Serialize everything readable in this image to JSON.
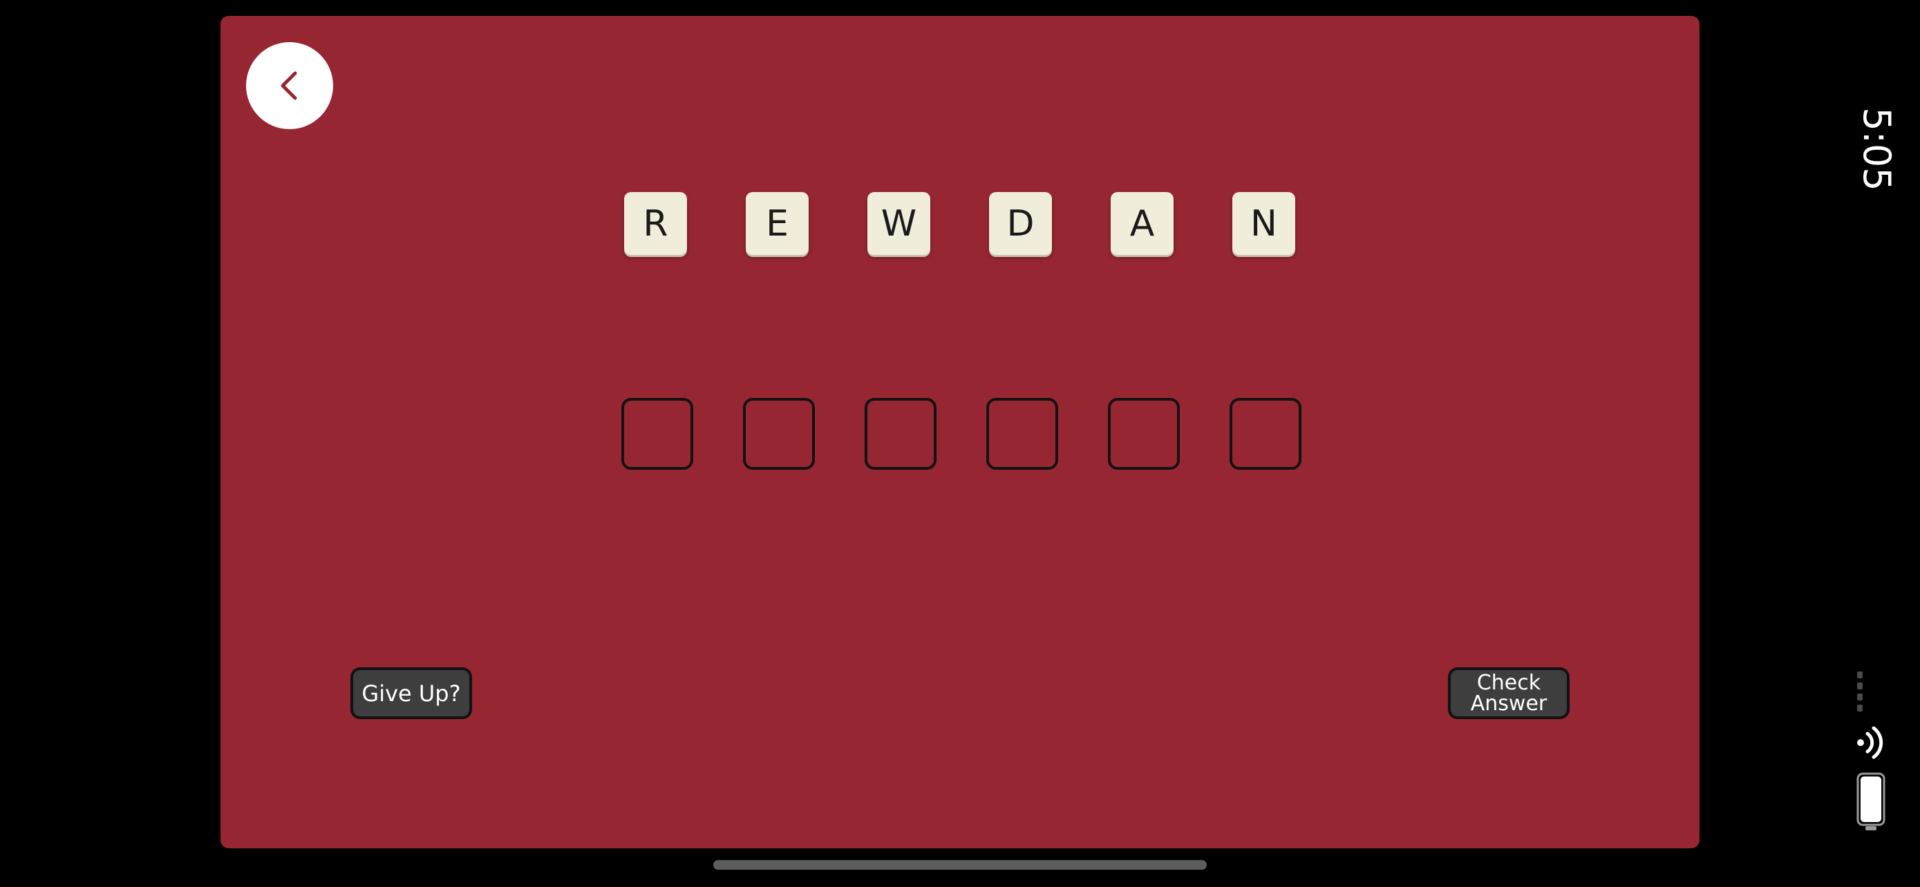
{
  "colors": {
    "panel": "#972633",
    "tile": "#f1eddb",
    "slot_border": "#121212",
    "button": "#3e3e3e",
    "back_arrow": "#972633"
  },
  "status": {
    "time": "5:05"
  },
  "nav": {
    "back_icon": "chevron-left-icon"
  },
  "tiles": [
    "R",
    "E",
    "W",
    "D",
    "A",
    "N"
  ],
  "answer_slots": [
    "",
    "",
    "",
    "",
    "",
    ""
  ],
  "buttons": {
    "give_up": "Give Up?",
    "check_answer": "Check\nAnswer"
  }
}
